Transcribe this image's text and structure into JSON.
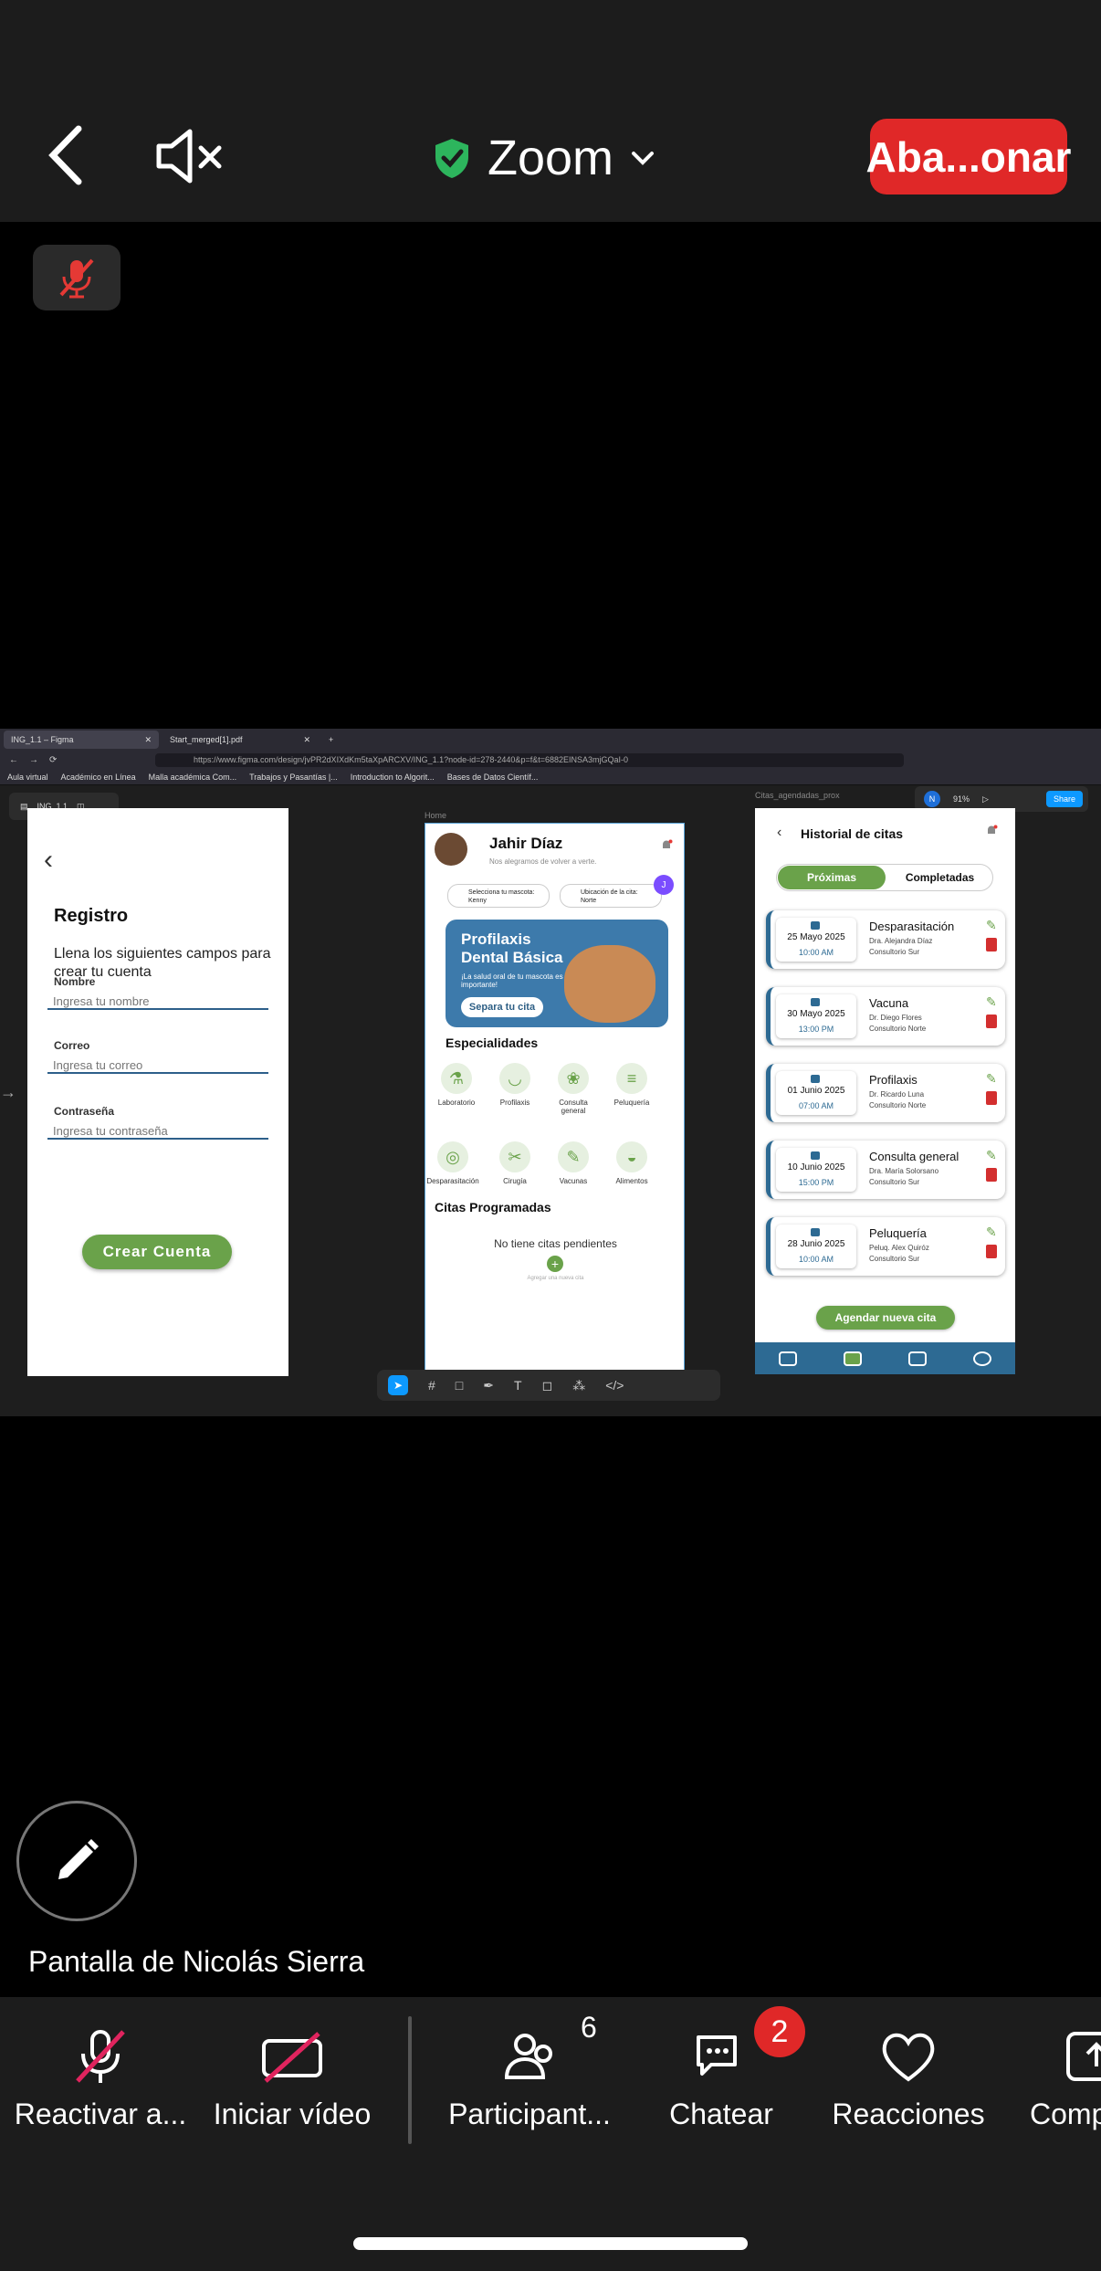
{
  "app": {
    "title": "Zoom",
    "leave_label": "Aba...onar"
  },
  "browser": {
    "tabs": [
      {
        "label": "ING_1.1 – Figma"
      },
      {
        "label": "Start_merged[1].pdf"
      }
    ],
    "url": "https://www.figma.com/design/jvPR2dXIXdKm5taXpARCXV/ING_1.1?node-id=278-2440&p=f&t=6882EINSA3mjGQaI-0",
    "bookmarks": [
      "Aula virtual",
      "Académico en Línea",
      "Malla académica Com...",
      "Trabajos y Pasantías |...",
      "Introduction to Algorit...",
      "Bases de Datos Científ..."
    ]
  },
  "figma": {
    "file_name": "ING_1.1",
    "zoom": "91%",
    "user_initial": "N",
    "share_label": "Share",
    "frame_labels": {
      "home": "Home",
      "citas": "Citas_agendadas_prox"
    }
  },
  "registro": {
    "title": "Registro",
    "subtitle": "Llena los siguientes campos para crear tu cuenta",
    "fields": [
      {
        "label": "Nombre",
        "placeholder": "Ingresa tu nombre"
      },
      {
        "label": "Correo",
        "placeholder": "Ingresa tu correo"
      },
      {
        "label": "Contraseña",
        "placeholder": "Ingresa tu contraseña"
      }
    ],
    "button": "Crear Cuenta"
  },
  "home": {
    "user_name": "Jahir Díaz",
    "greeting": "Nos alegramos de volver a verte.",
    "pet_select": {
      "label": "Selecciona tu mascota:",
      "value": "Kenny"
    },
    "location_select": {
      "label": "Ubicación de la cita:",
      "value": "Norte"
    },
    "cursor_badge": "J",
    "banner": {
      "title": "Profilaxis Dental Básica",
      "text": "¡La salud oral de tu mascota es importante!",
      "button": "Separa tu cita"
    },
    "specialties_title": "Especialidades",
    "specialties": [
      "Laboratorio",
      "Profilaxis",
      "Consulta general",
      "Peluquería",
      "Desparasitación",
      "Cirugía",
      "Vacunas",
      "Alimentos"
    ],
    "appointments_title": "Citas Programadas",
    "empty_text": "No tiene citas pendientes",
    "add_label": "Agregar una nueva cita"
  },
  "historial": {
    "title": "Historial de citas",
    "tabs": [
      "Próximas",
      "Completadas"
    ],
    "cards": [
      {
        "date": "25 Mayo 2025",
        "time": "10:00 AM",
        "service": "Desparasitación",
        "doctor": "Dra. Alejandra Díaz",
        "location": "Consultorio Sur"
      },
      {
        "date": "30 Mayo 2025",
        "time": "13:00 PM",
        "service": "Vacuna",
        "doctor": "Dr. Diego Flores",
        "location": "Consultorio Norte"
      },
      {
        "date": "01 Junio 2025",
        "time": "07:00 AM",
        "service": "Profilaxis",
        "doctor": "Dr. Ricardo Luna",
        "location": "Consultorio Norte"
      },
      {
        "date": "10 Junio 2025",
        "time": "15:00 PM",
        "service": "Consulta general",
        "doctor": "Dra. María Solorsano",
        "location": "Consultorio Sur"
      },
      {
        "date": "28 Junio 2025",
        "time": "10:00 AM",
        "service": "Peluquería",
        "doctor": "Peluq. Alex Quiróz",
        "location": "Consultorio Sur"
      }
    ],
    "button": "Agendar nueva cita"
  },
  "meeting": {
    "screen_owner": "Pantalla de Nicolás Sierra",
    "participants_count": "6",
    "chat_badge": "2",
    "controls": [
      "Reactivar a...",
      "Iniciar vídeo",
      "Participant...",
      "Chatear",
      "Reacciones",
      "Comp"
    ]
  },
  "colors": {
    "leave": "#e02828",
    "accent_green": "#6aa24a",
    "accent_blue": "#2d6a93"
  }
}
